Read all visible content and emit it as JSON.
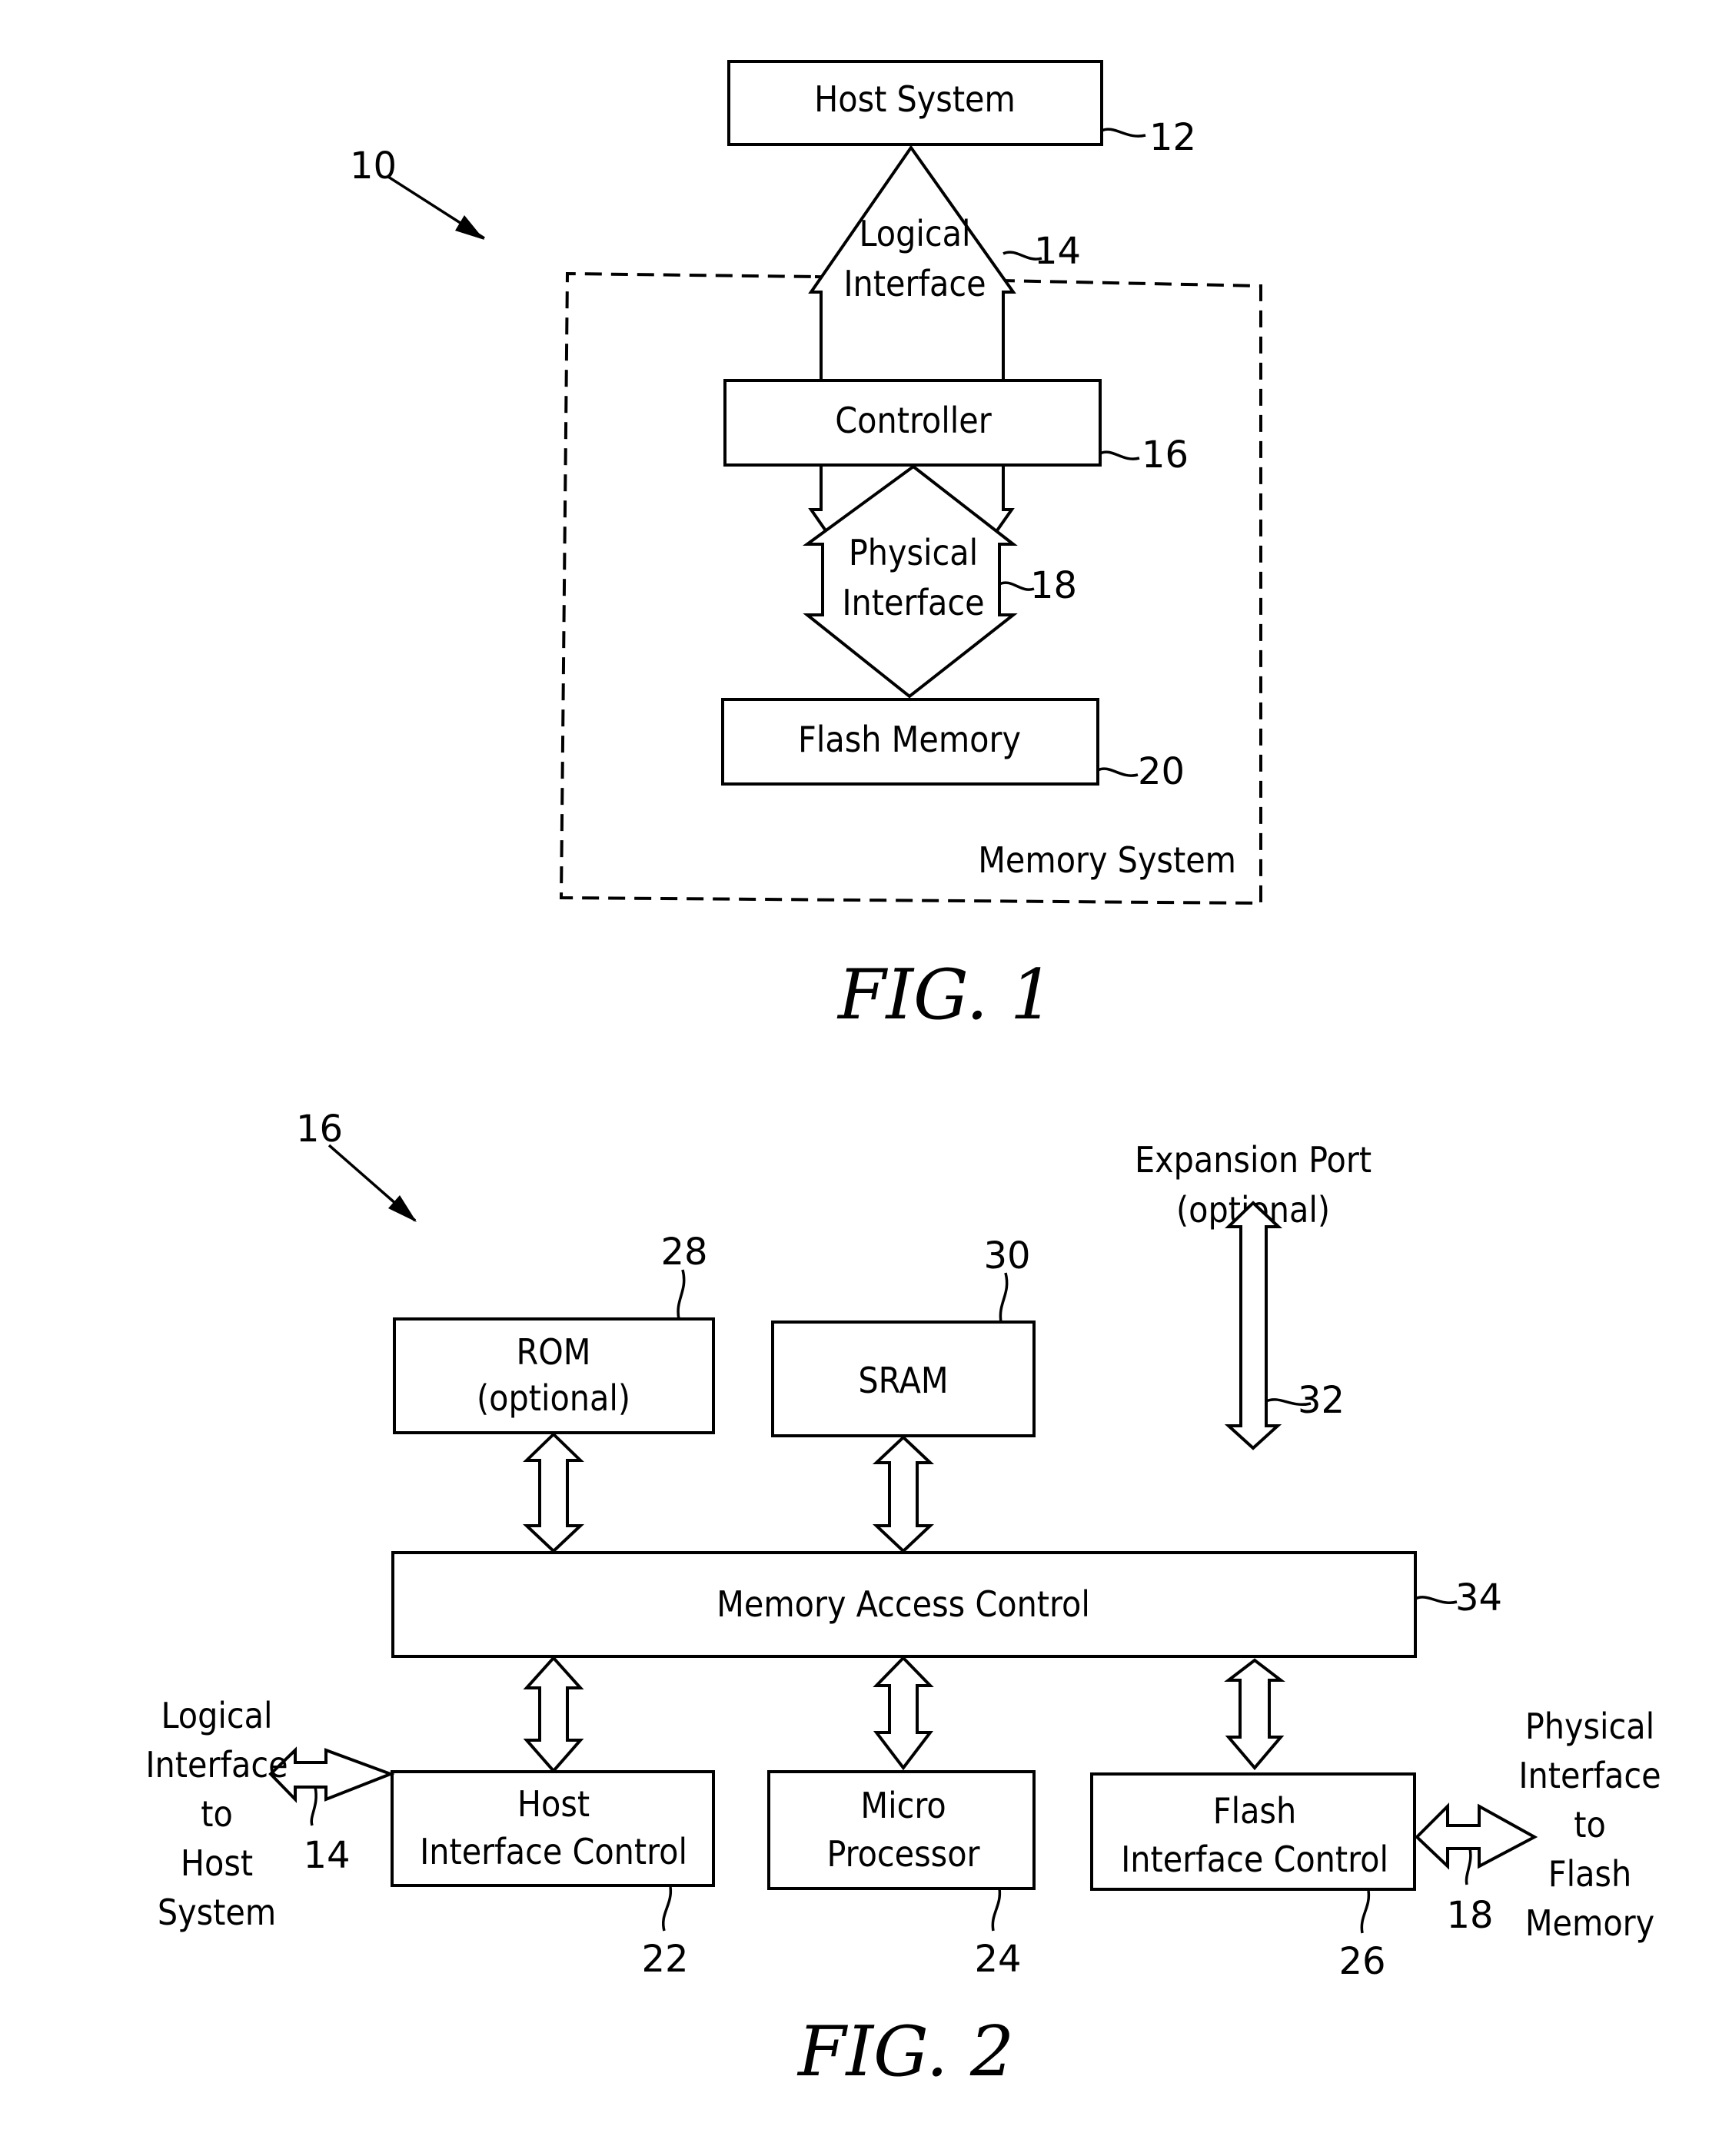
{
  "fig1": {
    "caption": "FIG. 1",
    "overall_ref": "10",
    "host_system": {
      "label": "Host System",
      "ref": "12"
    },
    "logical_interface": {
      "line1": "Logical",
      "line2": "Interface",
      "ref": "14"
    },
    "controller": {
      "label": "Controller",
      "ref": "16"
    },
    "physical_interface": {
      "line1": "Physical",
      "line2": "Interface",
      "ref": "18"
    },
    "flash_memory": {
      "label": "Flash Memory",
      "ref": "20"
    },
    "memory_system_label": "Memory System"
  },
  "fig2": {
    "caption": "FIG. 2",
    "overall_ref": "16",
    "rom": {
      "line1": "ROM",
      "line2": "(optional)",
      "ref": "28"
    },
    "sram": {
      "label": "SRAM",
      "ref": "30"
    },
    "expansion_port": {
      "line1": "Expansion Port",
      "line2": "(optional)",
      "ref": "32"
    },
    "memory_access_control": {
      "label": "Memory Access Control",
      "ref": "34"
    },
    "host_interface_control": {
      "line1": "Host",
      "line2": "Interface Control",
      "ref": "22"
    },
    "micro_processor": {
      "line1": "Micro",
      "line2": "Processor",
      "ref": "24"
    },
    "flash_interface_control": {
      "line1": "Flash",
      "line2": "Interface Control",
      "ref": "26"
    },
    "logical_interface_side": {
      "lines": [
        "Logical",
        "Interface",
        "to",
        "Host",
        "System"
      ],
      "ref": "14"
    },
    "physical_interface_side": {
      "lines": [
        "Physical",
        "Interface",
        "to",
        "Flash",
        "Memory"
      ],
      "ref": "18"
    }
  }
}
